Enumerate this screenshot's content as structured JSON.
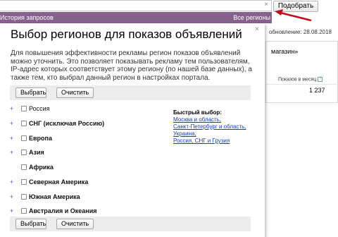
{
  "background": {
    "search_clear_icon": "close-icon",
    "pick_button": "Подобрать",
    "history_label": "История запросов",
    "regions_label": "Все регионы",
    "update_text": "обновление: 28.08.2018",
    "shop_text": "магазин»",
    "column_header": "Показов в месяц",
    "help_icon": "?",
    "value": "1 237",
    "accent_purple": "#87628f",
    "arrow_color": "#c0101a"
  },
  "modal": {
    "close_icon": "×",
    "title": "Выбор регионов для показов объявлений",
    "description": "Для повышения эффективности рекламы регион показов объявлений можно уточнить. Это позволяет показывать рекламу тем пользователям, IP-адрес которых соответствует этому региону (по нашей базе данных), а также тем, кто выбрал данный регион в настройках портала.",
    "select_button": "Выбрать",
    "clear_button": "Очистить",
    "regions": [
      {
        "label": "Россия",
        "expandable": true,
        "bold": false
      },
      {
        "label": "СНГ (исключая Россию)",
        "expandable": true,
        "bold": true
      },
      {
        "label": "Европа",
        "expandable": true,
        "bold": true
      },
      {
        "label": "Азия",
        "expandable": true,
        "bold": true
      },
      {
        "label": "Африка",
        "expandable": false,
        "bold": true
      },
      {
        "label": "Северная Америка",
        "expandable": true,
        "bold": true
      },
      {
        "label": "Южная Америка",
        "expandable": true,
        "bold": true
      },
      {
        "label": "Австралия и Океания",
        "expandable": true,
        "bold": true
      }
    ],
    "quick": {
      "title": "Быстрый выбор:",
      "links": [
        "Москва и область,",
        "Санкт-Петербург и область,",
        "Украина,",
        "Россия, СНГ и Грузия"
      ]
    },
    "link_color": "#1a3caf"
  }
}
